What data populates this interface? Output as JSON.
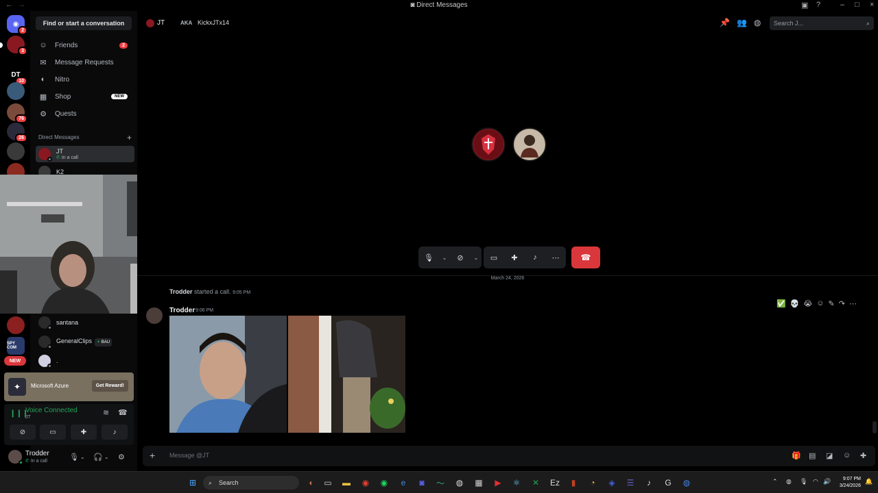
{
  "window": {
    "title": "Direct Messages"
  },
  "rail": {
    "home_badge": "2",
    "servers": [
      {
        "label": "",
        "badge": "3",
        "color": "#8a1820"
      },
      {
        "label": "DT",
        "badge": "10",
        "color": "#000000"
      },
      {
        "label": "",
        "badge": "",
        "color": "#3a5a7a"
      },
      {
        "label": "",
        "badge": "76",
        "color": "#7a4a3a"
      },
      {
        "label": "",
        "badge": "26",
        "color": "#2a2a3a"
      },
      {
        "label": "",
        "badge": "",
        "color": "#3a3a3a"
      },
      {
        "label": "",
        "badge": "",
        "color": "#8a2a20"
      }
    ],
    "lower_servers": [
      {
        "label": "",
        "color": "#8a2020"
      },
      {
        "label": "SPY COM",
        "color": "#2a3a6a"
      },
      {
        "label": "NEW",
        "color": "#da373c"
      }
    ]
  },
  "sidebar": {
    "find_label": "Find or start a conversation",
    "nav": [
      {
        "label": "Friends",
        "icon": "friends-icon",
        "glyph": "☺",
        "count": "2"
      },
      {
        "label": "Message Requests",
        "icon": "mail-icon",
        "glyph": "✉",
        "count": ""
      },
      {
        "label": "Nitro",
        "icon": "nitro-icon",
        "glyph": "◐",
        "count": ""
      },
      {
        "label": "Shop",
        "icon": "shop-icon",
        "glyph": "▦",
        "tag": "NEW"
      },
      {
        "label": "Quests",
        "icon": "quests-icon",
        "glyph": "⚙",
        "count": ""
      }
    ],
    "dm_header": "Direct Messages",
    "dms": [
      {
        "name": "JT",
        "sub": "In a call",
        "color": "#8a1820",
        "status": "#80848e"
      },
      {
        "name": "K2",
        "sub": "",
        "color": "#3a3a3a",
        "status": "#80848e"
      }
    ],
    "lower_dms": [
      {
        "name": "santana",
        "tag": "",
        "color": "#2a2a2a"
      },
      {
        "name": "GeneralClips",
        "tag": "BAU",
        "color": "#2a2a2a"
      },
      {
        "name": ".",
        "tag": "",
        "color": "#d0d0e0"
      }
    ],
    "promo": {
      "name": "Microsoft Azure",
      "button": "Get Reward!"
    },
    "voice": {
      "title": "Voice Connected",
      "channel": "JT"
    },
    "user": {
      "name": "Trodder",
      "status": "In a call"
    }
  },
  "header": {
    "name": "JT",
    "aka": "AKA",
    "handle": "KickxJTx14",
    "search_placeholder": "Search J..."
  },
  "call": {
    "controls": [
      "mic",
      "camera",
      "screen",
      "activities",
      "soundboard",
      "more"
    ]
  },
  "messages": {
    "date": "March 24, 2026",
    "system": {
      "author": "Trodder",
      "text": "started a call.",
      "time": "9:05 PM"
    },
    "post": {
      "author": "Trodder",
      "time": "9:06 PM"
    }
  },
  "composer": {
    "placeholder": "Message @JT"
  },
  "taskbar": {
    "search": "Search",
    "time": "9:07 PM",
    "date": "3/24/2026"
  },
  "colors": {
    "accent": "#5865f2",
    "danger": "#da373c",
    "online": "#23a55a"
  }
}
